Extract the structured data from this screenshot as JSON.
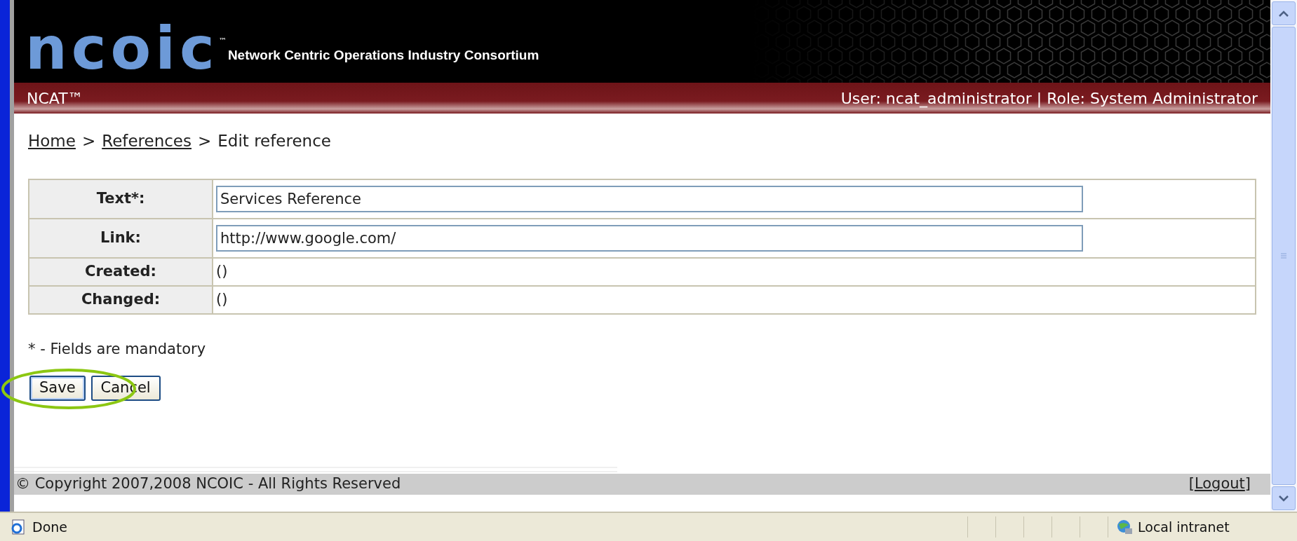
{
  "header": {
    "logo": "ncoic",
    "logo_mark": "™",
    "tagline": "Network Centric Operations Industry Consortium"
  },
  "nav_bar": {
    "app_name": "NCAT™",
    "user_info": "User: ncat_administrator | Role: System Administrator"
  },
  "breadcrumb": [
    {
      "label": "Home",
      "kind": "link"
    },
    {
      "label": ">",
      "kind": "separator"
    },
    {
      "label": "References",
      "kind": "link"
    },
    {
      "label": ">",
      "kind": "separator"
    },
    {
      "label": "Edit reference",
      "kind": "current"
    }
  ],
  "form": {
    "rows": [
      {
        "label": "Text*:",
        "kind": "input",
        "value": "Services Reference"
      },
      {
        "label": "Link:",
        "kind": "input",
        "value": "http://www.google.com/"
      },
      {
        "label": "Created:",
        "kind": "text",
        "value": "()"
      },
      {
        "label": "Changed:",
        "kind": "text",
        "value": "()"
      }
    ]
  },
  "note": "* - Fields are mandatory",
  "buttons": [
    {
      "label": "Save",
      "highlighted": true
    },
    {
      "label": "Cancel",
      "highlighted": false
    }
  ],
  "footer": {
    "copyright": "© Copyright 2007,2008 NCOIC - All Rights Reserved",
    "logout_open": "[",
    "logout": "Logout",
    "logout_close": "]"
  },
  "status_bar": {
    "status": "Done",
    "zone": "Local intranet"
  }
}
